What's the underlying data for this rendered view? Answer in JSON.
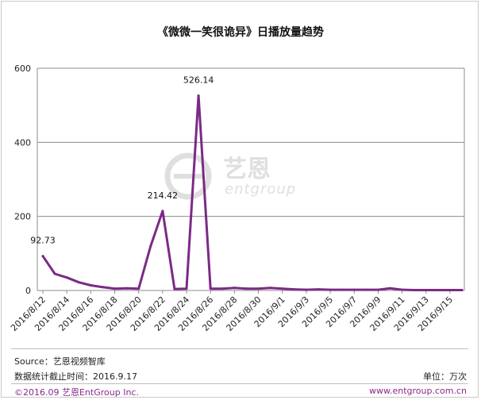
{
  "chart_data": {
    "type": "line",
    "title": "《微微一笑很诡异》日播放量趋势",
    "xlabel": "",
    "ylabel": "",
    "ylim": [
      0,
      600
    ],
    "yticks": [
      0,
      200,
      400,
      600
    ],
    "grid": true,
    "legend": "none",
    "line_color": "#7b2a86",
    "x": [
      "2016/8/12",
      "2016/8/13",
      "2016/8/14",
      "2016/8/15",
      "2016/8/16",
      "2016/8/17",
      "2016/8/18",
      "2016/8/19",
      "2016/8/20",
      "2016/8/21",
      "2016/8/22",
      "2016/8/23",
      "2016/8/24",
      "2016/8/25",
      "2016/8/26",
      "2016/8/27",
      "2016/8/28",
      "2016/8/29",
      "2016/8/30",
      "2016/8/31",
      "2016/9/1",
      "2016/9/2",
      "2016/9/3",
      "2016/9/4",
      "2016/9/5",
      "2016/9/6",
      "2016/9/7",
      "2016/9/8",
      "2016/9/9",
      "2016/9/10",
      "2016/9/11",
      "2016/9/12",
      "2016/9/13",
      "2016/9/14",
      "2016/9/15",
      "2016/9/16"
    ],
    "xtick_labels": [
      "2016/8/12",
      "2016/8/14",
      "2016/8/16",
      "2016/8/18",
      "2016/8/20",
      "2016/8/22",
      "2016/8/24",
      "2016/8/26",
      "2016/8/28",
      "2016/8/30",
      "2016/9/1",
      "2016/9/3",
      "2016/9/5",
      "2016/9/7",
      "2016/9/9",
      "2016/9/11",
      "2016/9/13",
      "2016/9/15"
    ],
    "values": [
      92.73,
      45,
      35,
      22,
      14,
      9,
      5,
      6,
      5,
      120,
      214.42,
      4,
      5,
      526.14,
      5,
      5,
      7,
      5,
      5,
      7,
      5,
      3,
      2,
      3,
      2,
      2,
      2,
      2,
      2,
      6,
      2,
      1,
      1,
      1,
      1,
      1
    ],
    "data_labels": [
      {
        "index": 0,
        "text": "92.73"
      },
      {
        "index": 10,
        "text": "214.42"
      },
      {
        "index": 13,
        "text": "526.14"
      }
    ]
  },
  "watermark": {
    "cn": "艺恩",
    "en": "entgroup"
  },
  "footer": {
    "source": "Source：艺恩视频智库",
    "cutoff": "数据统计截止时间：2016.9.17",
    "unit": "单位：万次",
    "copyright": "©2016.09  艺恩EntGroup Inc.",
    "website": "www.entgroup.com.cn"
  }
}
